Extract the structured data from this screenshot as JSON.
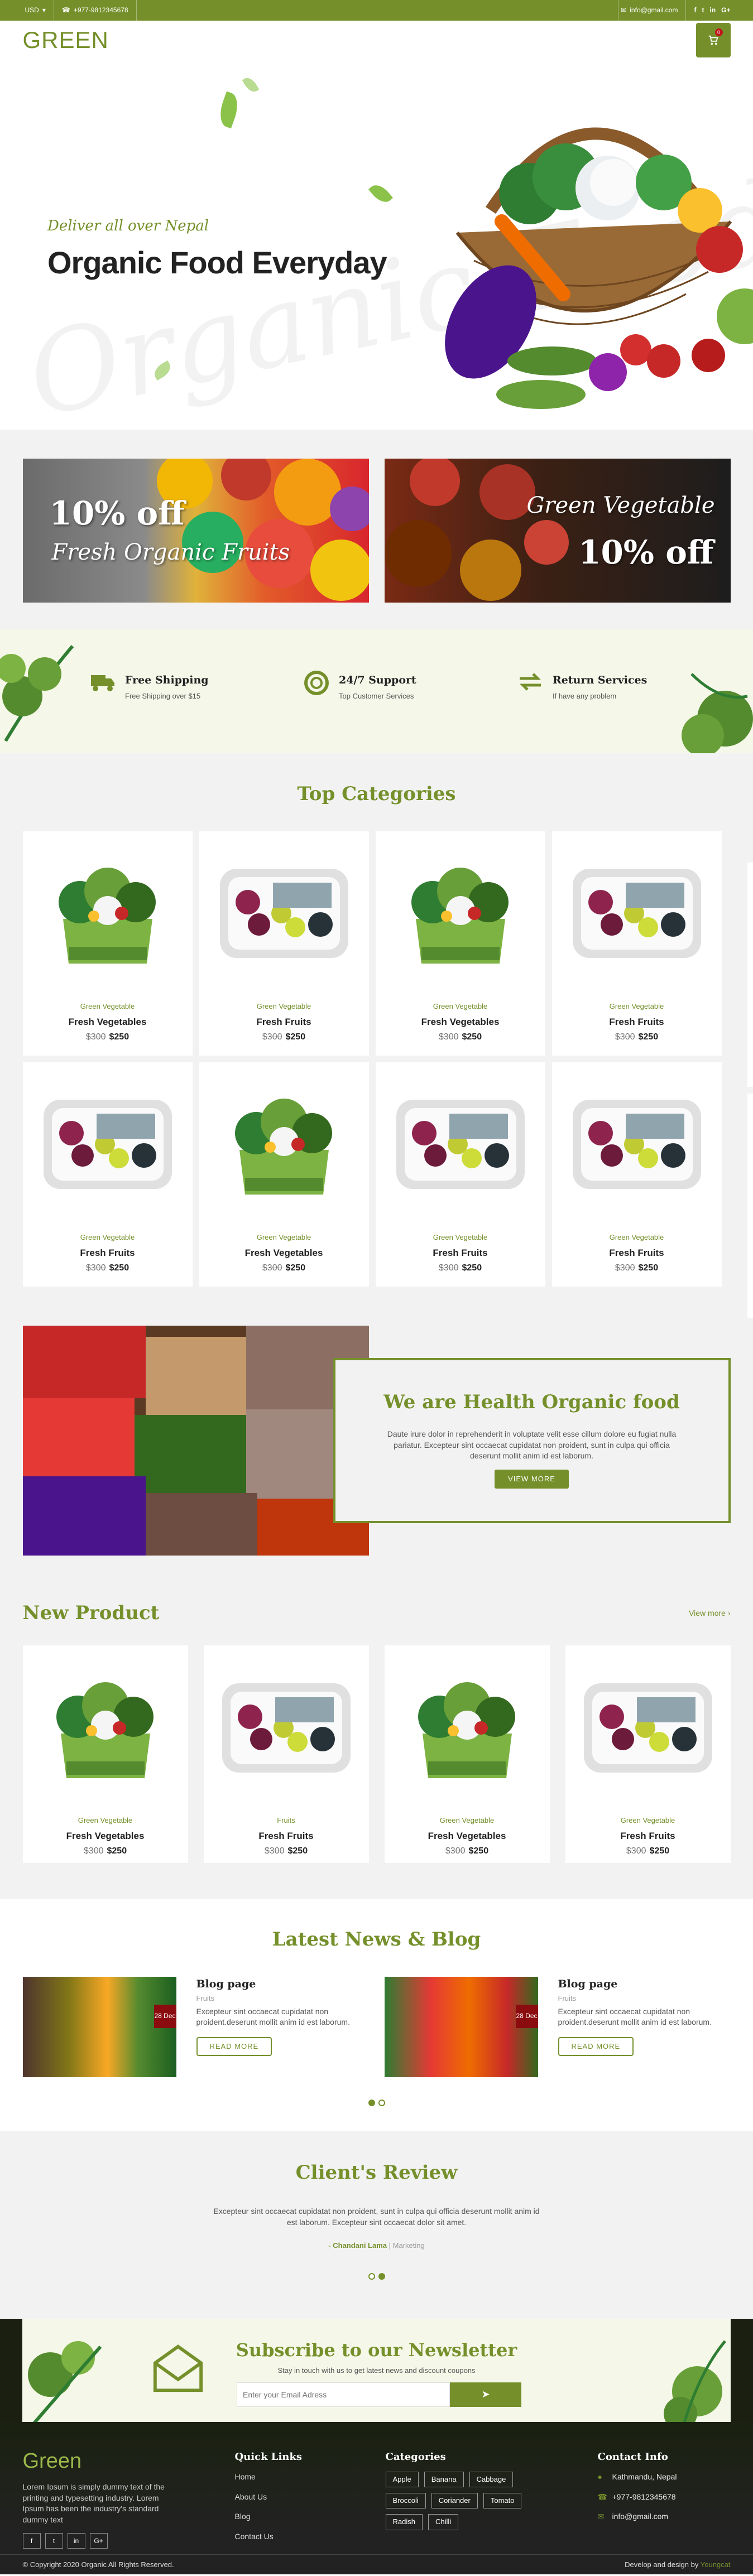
{
  "topbar": {
    "currency": "USD",
    "phone": "+977-9812345678",
    "email": "info@gmail.com",
    "social": [
      "f",
      "t",
      "in",
      "G+"
    ]
  },
  "header": {
    "logo": "GREEN",
    "cart_count": "0"
  },
  "hero": {
    "ghost_text": "Organic Food",
    "tagline": "Deliver all over Nepal",
    "title": "Organic Food Everyday"
  },
  "promos": [
    {
      "line1": "10% off",
      "line2": "Fresh Organic Fruits"
    },
    {
      "line1": "Green Vegetable",
      "line2": "10% off"
    }
  ],
  "features": [
    {
      "icon": "truck-icon",
      "title": "Free Shipping",
      "desc": "Free Shipping over $15"
    },
    {
      "icon": "lifebuoy-icon",
      "title": "24/7 Support",
      "desc": "Top Customer Services"
    },
    {
      "icon": "exchange-icon",
      "title": "Return Services",
      "desc": "If have any problem"
    }
  ],
  "categories": {
    "title": "Top Categories",
    "products": [
      {
        "type": "salad",
        "category": "Green Vegetable",
        "name": "Fresh Vegetables",
        "old_price": "$300",
        "price": "$250"
      },
      {
        "type": "tray",
        "category": "Green Vegetable",
        "name": "Fresh Fruits",
        "old_price": "$300",
        "price": "$250"
      },
      {
        "type": "salad",
        "category": "Green Vegetable",
        "name": "Fresh Vegetables",
        "old_price": "$300",
        "price": "$250"
      },
      {
        "type": "tray",
        "category": "Green Vegetable",
        "name": "Fresh Fruits",
        "old_price": "$300",
        "price": "$250"
      },
      {
        "type": "tray",
        "category": "Green Vegetable",
        "name": "Fresh Fruits",
        "old_price": "$300",
        "price": "$250"
      },
      {
        "type": "salad",
        "category": "Green Vegetable",
        "name": "Fresh Vegetables",
        "old_price": "$300",
        "price": "$250"
      },
      {
        "type": "tray",
        "category": "Green Vegetable",
        "name": "Fresh Fruits",
        "old_price": "$300",
        "price": "$250"
      },
      {
        "type": "tray",
        "category": "Green Vegetable",
        "name": "Fresh Fruits",
        "old_price": "$300",
        "price": "$250"
      }
    ]
  },
  "about": {
    "title": "We are Health Organic food",
    "text": "Daute irure dolor in reprehenderit in voluptate velit esse cillum dolore eu fugiat nulla pariatur. Excepteur sint occaecat cupidatat non proident, sunt in culpa qui officia deserunt mollit anim id est laborum.",
    "button": "VIEW MORE"
  },
  "new_product": {
    "title": "New Product",
    "view_more": "View more",
    "products": [
      {
        "type": "salad",
        "category": "Green Vegetable",
        "name": "Fresh Vegetables",
        "old_price": "$300",
        "price": "$250"
      },
      {
        "type": "tray",
        "category": "Fruits",
        "name": "Fresh Fruits",
        "old_price": "$300",
        "price": "$250"
      },
      {
        "type": "salad",
        "category": "Green Vegetable",
        "name": "Fresh Vegetables",
        "old_price": "$300",
        "price": "$250"
      },
      {
        "type": "tray",
        "category": "Green Vegetable",
        "name": "Fresh Fruits",
        "old_price": "$300",
        "price": "$250"
      }
    ]
  },
  "blog": {
    "title": "Latest News & Blog",
    "posts": [
      {
        "date": "28 Dec",
        "title": "Blog page",
        "category": "Fruits",
        "text": "Excepteur sint occaecat cupidatat non proident.deserunt mollit anim id est laborum.",
        "button": "READ MORE"
      },
      {
        "date": "28 Dec",
        "title": "Blog page",
        "category": "Fruits",
        "text": "Excepteur sint occaecat cupidatat non proident.deserunt mollit anim id est laborum.",
        "button": "READ MORE"
      }
    ]
  },
  "review": {
    "title": "Client's Review",
    "text": "Excepteur sint occaecat cupidatat non proident, sunt in culpa qui officia deserunt mollit anim id est laborum. Excepteur sint occaecat dolor sit amet.",
    "author": "- Chandani Lama",
    "role": "Marketing"
  },
  "newsletter": {
    "title": "Subscribe to our Newsletter",
    "subtitle": "Stay in touch with us to get latest news and discount coupons",
    "placeholder": "Enter your Email Adress"
  },
  "footer": {
    "logo": "Green",
    "about": "Lorem Ipsum is simply dummy text of the printing and typesetting industry. Lorem Ipsum has been the industry's standard dummy text",
    "social": [
      "f",
      "t",
      "in",
      "G+"
    ],
    "quick_links_title": "Quick Links",
    "quick_links": [
      "Home",
      "About Us",
      "Blog",
      "Contact Us"
    ],
    "categories_title": "Categories",
    "categories": [
      "Apple",
      "Banana",
      "Cabbage",
      "Broccoli",
      "Coriander",
      "Tomato",
      "Radish",
      "Chilli"
    ],
    "contact_title": "Contact Info",
    "address": "Kathmandu, Nepal",
    "phone": "+977-9812345678",
    "email": "info@gmail.com",
    "copyright": "© Copyright 2020 Organic All Rights Reserved.",
    "credit": "Develop and design by",
    "credit_name": "Youngcat"
  },
  "colors": {
    "brand": "#75902b",
    "date_badge": "#8b0c0f"
  }
}
